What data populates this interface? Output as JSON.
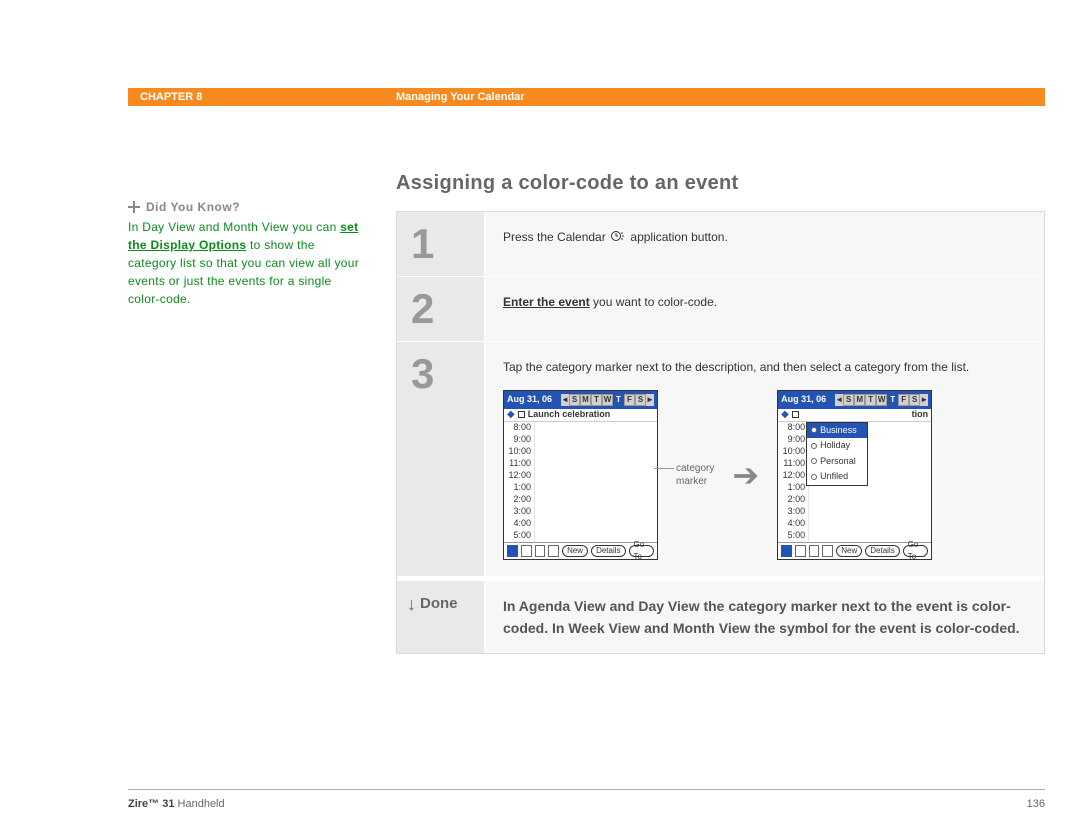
{
  "header": {
    "chapter": "CHAPTER 8",
    "title": "Managing Your Calendar"
  },
  "sidebar": {
    "heading": "Did You Know?",
    "text_before_link": "In Day View and Month View you can ",
    "link": "set the Display Options",
    "text_after_link": " to show the category list so that you can view all your events or just the events for a single color-code."
  },
  "title": "Assigning a color-code to an event",
  "steps": [
    {
      "num": "1",
      "pre": "Press the Calendar ",
      "post": " application button."
    },
    {
      "num": "2",
      "link": "Enter the event",
      "post": " you want to color-code."
    },
    {
      "num": "3",
      "text": "Tap the category marker next to the description, and then select a category from the list."
    }
  ],
  "annotation": {
    "line1": "category",
    "line2": "marker"
  },
  "screen": {
    "date": "Aug 31, 06",
    "days": [
      "S",
      "M",
      "T",
      "W",
      "T",
      "F",
      "S"
    ],
    "selected_day_index": 4,
    "event": "Launch celebration",
    "event_partial": "tion",
    "times": [
      "8:00",
      "9:00",
      "10:00",
      "11:00",
      "12:00",
      "1:00",
      "2:00",
      "3:00",
      "4:00",
      "5:00"
    ],
    "times_b": [
      "8:00",
      "9:00",
      "10:00",
      "11:00",
      "12:00",
      "1:00",
      "2:00",
      "3:00",
      "4:00",
      "5:00"
    ],
    "footer_buttons": [
      "New",
      "Details",
      "Go To"
    ],
    "dropdown": [
      "Business",
      "Holiday",
      "Personal",
      "Unfiled"
    ]
  },
  "done": {
    "label": "Done",
    "text": "In Agenda View and Day View the category marker next to the event is color-coded. In Week View and Month View the symbol for the event is color-coded."
  },
  "footer": {
    "product_bold": "Zire™ 31",
    "product_rest": " Handheld",
    "page": "136"
  }
}
